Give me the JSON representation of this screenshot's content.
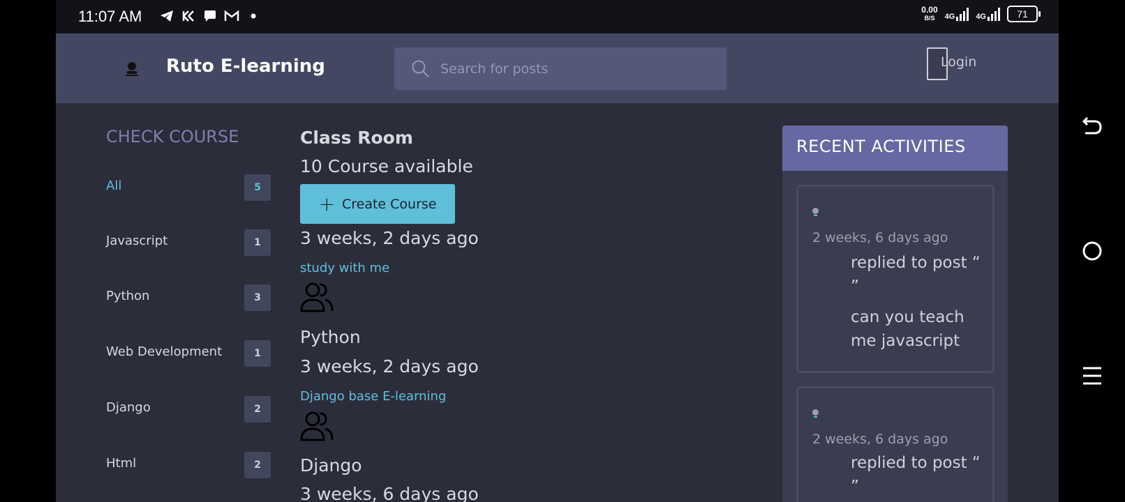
{
  "status": {
    "time": "11:07 AM",
    "net_speed": "0.00",
    "net_unit": "B/S",
    "net1": "4G",
    "net2": "4G",
    "battery": "71"
  },
  "header": {
    "brand": "Ruto E-learning",
    "search_placeholder": "Search for posts",
    "login": "Login"
  },
  "sidebar": {
    "title": "CHECK COURSE",
    "items": [
      {
        "label": "All",
        "count": "5"
      },
      {
        "label": "Javascript",
        "count": "1"
      },
      {
        "label": "Python",
        "count": "3"
      },
      {
        "label": "Web Development",
        "count": "1"
      },
      {
        "label": "Django",
        "count": "2"
      },
      {
        "label": "Html",
        "count": "2"
      }
    ]
  },
  "main": {
    "title": "Class Room",
    "available": "10 Course available",
    "create_label": "Create Course",
    "time0": "3 weeks, 2 days ago",
    "posts": [
      {
        "link": "study with me",
        "category": "Python",
        "time": "3 weeks, 2 days ago"
      },
      {
        "link": "Django base E-learning",
        "category": "Django",
        "time": "3 weeks, 6 days ago"
      }
    ]
  },
  "activities": {
    "title": "RECENT ACTIVITIES",
    "items": [
      {
        "time": "2 weeks, 6 days ago",
        "action": "replied to post “ ”",
        "message": "can you teach me javascript"
      },
      {
        "time": "2 weeks, 6 days ago",
        "action": "replied to post “ ”",
        "message": ""
      }
    ]
  }
}
